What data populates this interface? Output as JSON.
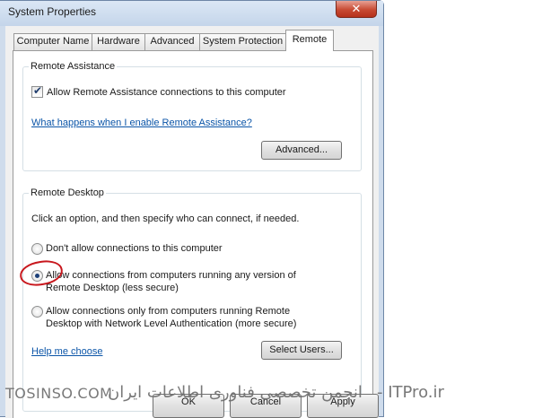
{
  "window": {
    "title": "System Properties",
    "close_glyph": "✕"
  },
  "tabs": [
    {
      "label": "Computer Name"
    },
    {
      "label": "Hardware"
    },
    {
      "label": "Advanced"
    },
    {
      "label": "System Protection"
    },
    {
      "label": "Remote"
    }
  ],
  "remote_assistance": {
    "group_label": "Remote Assistance",
    "checkbox_label": "Allow Remote Assistance connections to this computer",
    "checkbox_checked": true,
    "help_link": "What happens when I enable Remote Assistance?",
    "advanced_button": "Advanced..."
  },
  "remote_desktop": {
    "group_label": "Remote Desktop",
    "instruction": "Click an option, and then specify who can connect, if needed.",
    "option1_label": "Don't allow connections to this computer",
    "option2_line1": "Allow connections from computers running any version of",
    "option2_line2": "Remote Desktop (less secure)",
    "option3_line1": "Allow connections only from computers running Remote",
    "option3_line2": "Desktop with Network Level Authentication (more secure)",
    "selected_option": 2,
    "help_link": "Help me choose",
    "select_users_button": "Select Users..."
  },
  "buttons": {
    "ok": "OK",
    "cancel": "Cancel",
    "apply": "Apply"
  },
  "watermark": {
    "left": "TOSINSO.COM",
    "middle": "انجمن تخصصی فناوری اطلاعات ایران",
    "right": "- ITPro.ir"
  },
  "colors": {
    "annotation": "#c8171d",
    "link": "#0b55a8",
    "radio_selected": "#1c3f78"
  }
}
